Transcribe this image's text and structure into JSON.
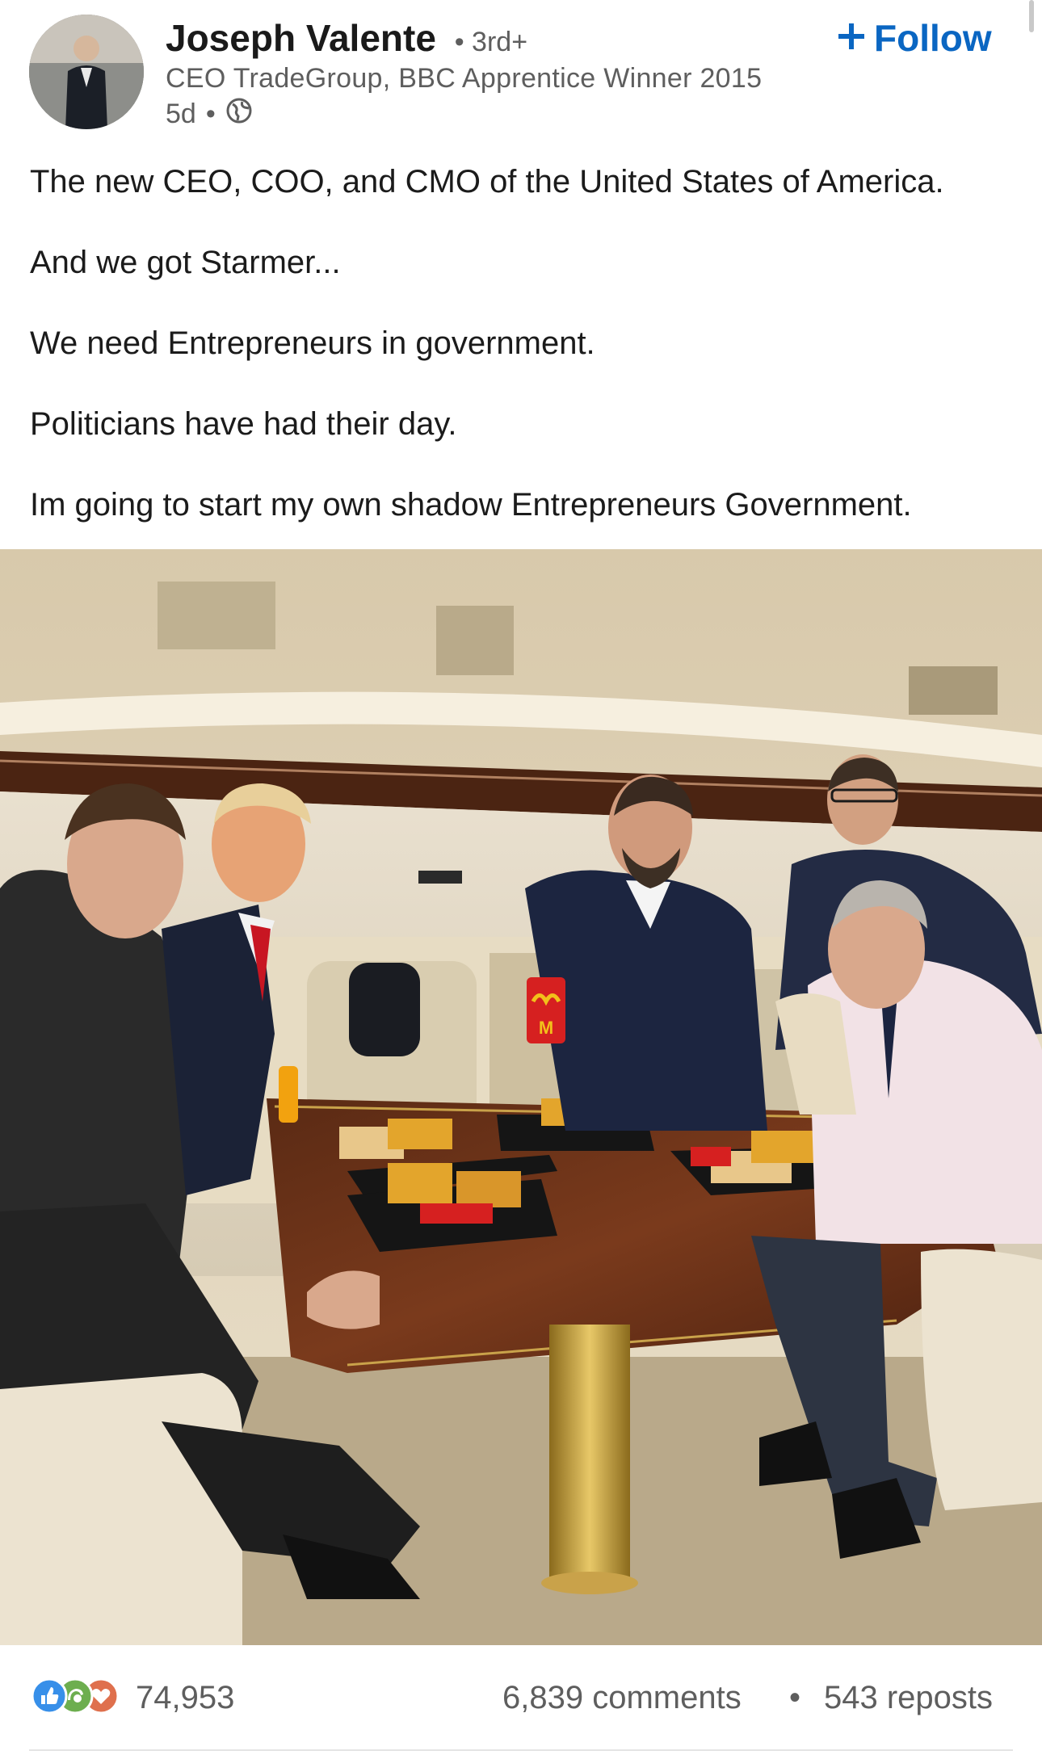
{
  "author": {
    "name": "Joseph Valente",
    "degree": "• 3rd+",
    "headline": "CEO TradeGroup, BBC Apprentice Winner 2015",
    "age": "5d",
    "meta_separator": "•",
    "visibility_icon": "globe-icon"
  },
  "follow": {
    "label": "Follow",
    "icon": "plus-icon",
    "color": "#0a66c2"
  },
  "post": {
    "paragraphs": [
      "The new CEO, COO, and CMO of the United States of America.",
      "And we got Starmer...",
      "We need Entrepreneurs in government.",
      "Politicians have had their day.",
      "Im going to start my own shadow Entrepreneurs Government."
    ]
  },
  "image": {
    "sign_text": "M"
  },
  "social": {
    "reaction_icons": [
      "like-icon",
      "celebrate-icon",
      "love-icon"
    ],
    "reaction_count": "74,953",
    "comments": "6,839 comments",
    "separator": "•",
    "reposts": "543 reposts"
  },
  "colors": {
    "link": "#0a66c2",
    "secondary_text": "#5e5e5e",
    "like": "#378fe9",
    "celebrate": "#44712e",
    "love": "#df704d"
  }
}
